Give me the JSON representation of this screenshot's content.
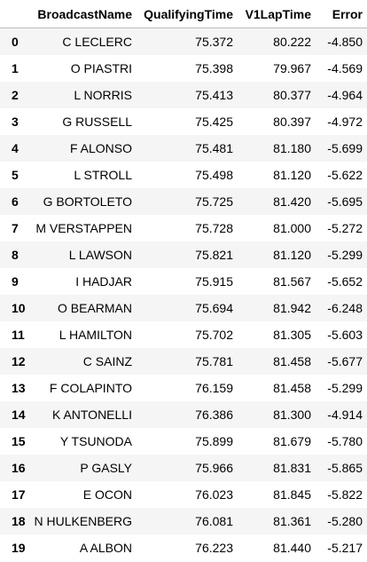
{
  "table": {
    "columns": [
      "",
      "BroadcastName",
      "QualifyingTime",
      "V1LapTime",
      "Error"
    ],
    "rows": [
      {
        "index": "0",
        "BroadcastName": "C LECLERC",
        "QualifyingTime": "75.372",
        "V1LapTime": "80.222",
        "Error": "-4.850"
      },
      {
        "index": "1",
        "BroadcastName": "O PIASTRI",
        "QualifyingTime": "75.398",
        "V1LapTime": "79.967",
        "Error": "-4.569"
      },
      {
        "index": "2",
        "BroadcastName": "L NORRIS",
        "QualifyingTime": "75.413",
        "V1LapTime": "80.377",
        "Error": "-4.964"
      },
      {
        "index": "3",
        "BroadcastName": "G RUSSELL",
        "QualifyingTime": "75.425",
        "V1LapTime": "80.397",
        "Error": "-4.972"
      },
      {
        "index": "4",
        "BroadcastName": "F ALONSO",
        "QualifyingTime": "75.481",
        "V1LapTime": "81.180",
        "Error": "-5.699"
      },
      {
        "index": "5",
        "BroadcastName": "L STROLL",
        "QualifyingTime": "75.498",
        "V1LapTime": "81.120",
        "Error": "-5.622"
      },
      {
        "index": "6",
        "BroadcastName": "G BORTOLETO",
        "QualifyingTime": "75.725",
        "V1LapTime": "81.420",
        "Error": "-5.695"
      },
      {
        "index": "7",
        "BroadcastName": "M VERSTAPPEN",
        "QualifyingTime": "75.728",
        "V1LapTime": "81.000",
        "Error": "-5.272"
      },
      {
        "index": "8",
        "BroadcastName": "L LAWSON",
        "QualifyingTime": "75.821",
        "V1LapTime": "81.120",
        "Error": "-5.299"
      },
      {
        "index": "9",
        "BroadcastName": "I HADJAR",
        "QualifyingTime": "75.915",
        "V1LapTime": "81.567",
        "Error": "-5.652"
      },
      {
        "index": "10",
        "BroadcastName": "O BEARMAN",
        "QualifyingTime": "75.694",
        "V1LapTime": "81.942",
        "Error": "-6.248"
      },
      {
        "index": "11",
        "BroadcastName": "L HAMILTON",
        "QualifyingTime": "75.702",
        "V1LapTime": "81.305",
        "Error": "-5.603"
      },
      {
        "index": "12",
        "BroadcastName": "C SAINZ",
        "QualifyingTime": "75.781",
        "V1LapTime": "81.458",
        "Error": "-5.677"
      },
      {
        "index": "13",
        "BroadcastName": "F COLAPINTO",
        "QualifyingTime": "76.159",
        "V1LapTime": "81.458",
        "Error": "-5.299"
      },
      {
        "index": "14",
        "BroadcastName": "K ANTONELLI",
        "QualifyingTime": "76.386",
        "V1LapTime": "81.300",
        "Error": "-4.914"
      },
      {
        "index": "15",
        "BroadcastName": "Y TSUNODA",
        "QualifyingTime": "75.899",
        "V1LapTime": "81.679",
        "Error": "-5.780"
      },
      {
        "index": "16",
        "BroadcastName": "P GASLY",
        "QualifyingTime": "75.966",
        "V1LapTime": "81.831",
        "Error": "-5.865"
      },
      {
        "index": "17",
        "BroadcastName": "E OCON",
        "QualifyingTime": "76.023",
        "V1LapTime": "81.845",
        "Error": "-5.822"
      },
      {
        "index": "18",
        "BroadcastName": "N HULKENBERG",
        "QualifyingTime": "76.081",
        "V1LapTime": "81.361",
        "Error": "-5.280"
      },
      {
        "index": "19",
        "BroadcastName": "A ALBON",
        "QualifyingTime": "76.223",
        "V1LapTime": "81.440",
        "Error": "-5.217"
      }
    ]
  }
}
